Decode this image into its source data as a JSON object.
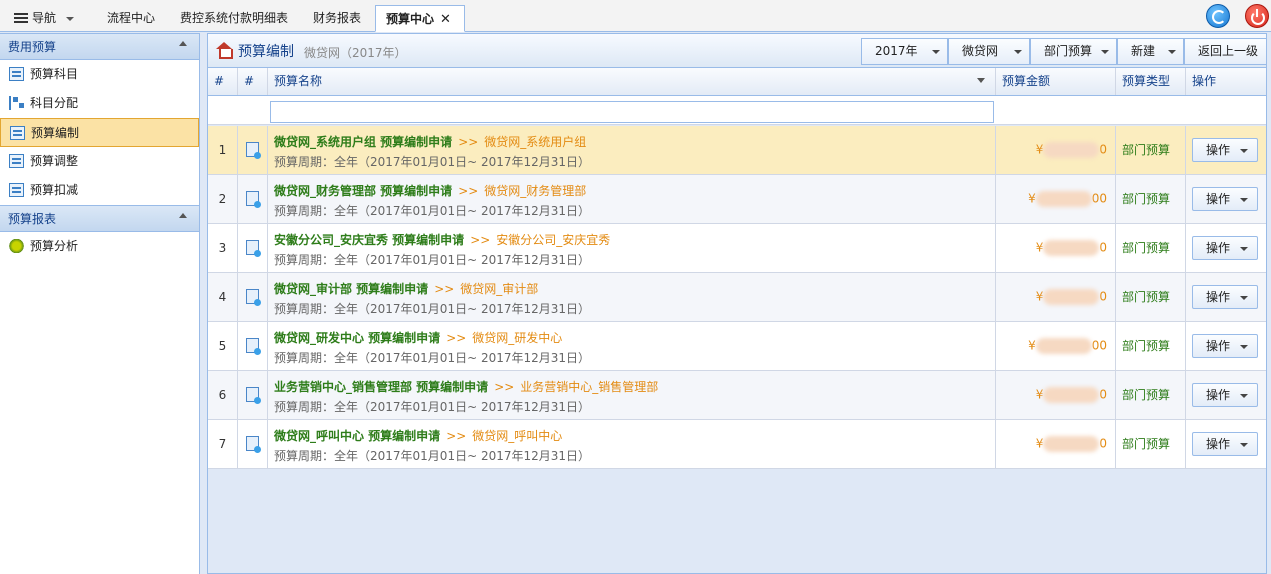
{
  "topbar": {
    "nav_label": "导航",
    "tabs": [
      "流程中心",
      "费控系统付款明细表",
      "财务报表"
    ],
    "active_tab": "预算中心",
    "close_glyph": "✕"
  },
  "sidebar": {
    "section1_title": "费用预算",
    "items": [
      "预算科目",
      "科目分配",
      "预算编制",
      "预算调整",
      "预算扣减"
    ],
    "section2_title": "预算报表",
    "report_items": [
      "预算分析"
    ]
  },
  "panel": {
    "title": "预算编制",
    "subtitle": "微贷网（2017年）",
    "toolbar": {
      "year": "2017年",
      "org": "微贷网",
      "type": "部门预算",
      "new": "新建",
      "back": "返回上一级"
    }
  },
  "grid": {
    "headers": {
      "idx": "#",
      "icon": "#",
      "name": "预算名称",
      "amount": "预算金额",
      "type": "预算类型",
      "op": "操作"
    },
    "filter_value": "",
    "rows": [
      {
        "idx": "1",
        "title": "微贷网_系统用户组 预算编制申请",
        "arrow": ">>",
        "target": "微贷网_系统用户组",
        "period": "预算周期：全年（2017年01月01日~ 2017年12月31日）",
        "amount_prefix": "¥",
        "amount_suffix": "0",
        "type": "部门预算",
        "op": "操作"
      },
      {
        "idx": "2",
        "title": "微贷网_财务管理部 预算编制申请",
        "arrow": ">>",
        "target": "微贷网_财务管理部",
        "period": "预算周期：全年（2017年01月01日~ 2017年12月31日）",
        "amount_prefix": "¥",
        "amount_suffix": "00",
        "type": "部门预算",
        "op": "操作"
      },
      {
        "idx": "3",
        "title": "安徽分公司_安庆宜秀 预算编制申请",
        "arrow": ">>",
        "target": "安徽分公司_安庆宜秀",
        "period": "预算周期：全年（2017年01月01日~ 2017年12月31日）",
        "amount_prefix": "¥",
        "amount_suffix": "0",
        "type": "部门预算",
        "op": "操作"
      },
      {
        "idx": "4",
        "title": "微贷网_审计部 预算编制申请",
        "arrow": ">>",
        "target": "微贷网_审计部",
        "period": "预算周期：全年（2017年01月01日~ 2017年12月31日）",
        "amount_prefix": "¥",
        "amount_suffix": "0",
        "type": "部门预算",
        "op": "操作"
      },
      {
        "idx": "5",
        "title": "微贷网_研发中心 预算编制申请",
        "arrow": ">>",
        "target": "微贷网_研发中心",
        "period": "预算周期：全年（2017年01月01日~ 2017年12月31日）",
        "amount_prefix": "¥",
        "amount_suffix": "00",
        "type": "部门预算",
        "op": "操作"
      },
      {
        "idx": "6",
        "title": "业务营销中心_销售管理部 预算编制申请",
        "arrow": ">>",
        "target": "业务营销中心_销售管理部",
        "period": "预算周期：全年（2017年01月01日~ 2017年12月31日）",
        "amount_prefix": "¥",
        "amount_suffix": "0",
        "type": "部门预算",
        "op": "操作"
      },
      {
        "idx": "7",
        "title": "微贷网_呼叫中心 预算编制申请",
        "arrow": ">>",
        "target": "微贷网_呼叫中心",
        "period": "预算周期：全年（2017年01月01日~ 2017年12月31日）",
        "amount_prefix": "¥",
        "amount_suffix": "0",
        "type": "部门预算",
        "op": "操作"
      }
    ]
  },
  "colors": {
    "accent": "#15428b",
    "apply_green": "#2e7d1a",
    "orange": "#e38b12",
    "selected_row": "#fbedbf"
  }
}
